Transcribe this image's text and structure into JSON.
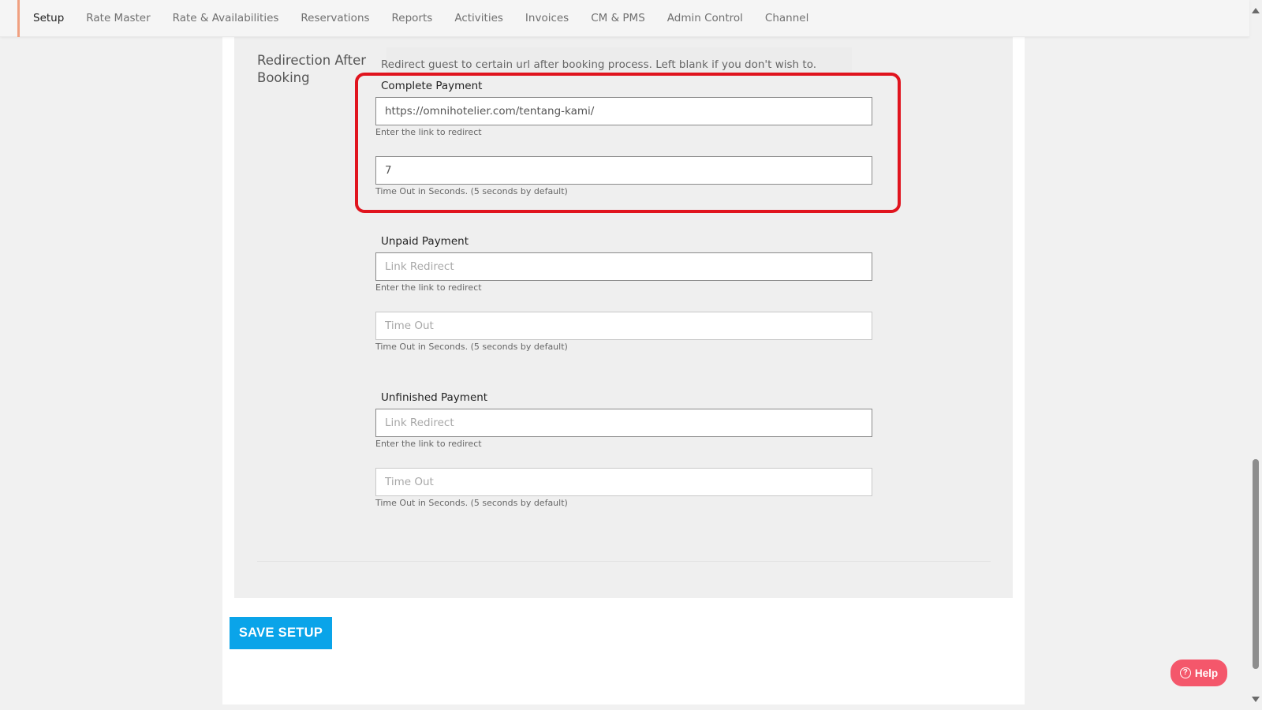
{
  "nav": {
    "tabs": [
      {
        "label": "Setup",
        "active": true
      },
      {
        "label": "Rate Master"
      },
      {
        "label": "Rate & Availabilities"
      },
      {
        "label": "Reservations"
      },
      {
        "label": "Reports"
      },
      {
        "label": "Activities"
      },
      {
        "label": "Invoices"
      },
      {
        "label": "CM & PMS"
      },
      {
        "label": "Admin Control"
      },
      {
        "label": "Channel"
      }
    ]
  },
  "section": {
    "title": "Redirection After Booking",
    "description": "Redirect guest to certain url after booking process. Left blank if you don't wish to."
  },
  "groups": {
    "complete": {
      "label": "Complete Payment",
      "link_value": "https://omnihotelier.com/tentang-kami/",
      "link_hint": "Enter the link to redirect",
      "timeout_value": "7",
      "timeout_hint": "Time Out in Seconds. (5 seconds by default)"
    },
    "unpaid": {
      "label": "Unpaid Payment",
      "link_placeholder": "Link Redirect",
      "link_hint": "Enter the link to redirect",
      "timeout_placeholder": "Time Out",
      "timeout_hint": "Time Out in Seconds. (5 seconds by default)"
    },
    "unfinished": {
      "label": "Unfinished Payment",
      "link_placeholder": "Link Redirect",
      "link_hint": "Enter the link to redirect",
      "timeout_placeholder": "Time Out",
      "timeout_hint": "Time Out in Seconds. (5 seconds by default)"
    }
  },
  "actions": {
    "save_label": "SAVE SETUP",
    "help_label": "Help"
  },
  "colors": {
    "accent_blue": "#0aa4e9",
    "help_pink": "#f4576b",
    "highlight_red": "#e0141e"
  }
}
